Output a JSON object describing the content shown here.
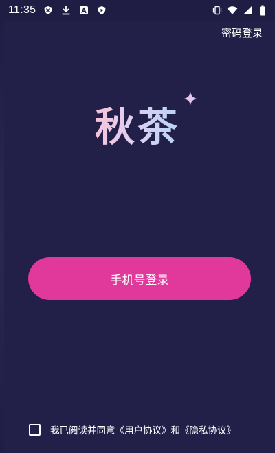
{
  "status_bar": {
    "time": "11:35",
    "left_icons": [
      "shield-x-icon",
      "download-icon",
      "font-a-icon",
      "play-shield-icon"
    ],
    "right_icons": [
      "vibrate-icon",
      "wifi-icon",
      "signal-icon",
      "battery-icon"
    ]
  },
  "header": {
    "password_login_label": "密码登录"
  },
  "logo": {
    "text": "秋茶",
    "decoration_icon": "sparkle-icon"
  },
  "main": {
    "phone_login_label": "手机号登录"
  },
  "agreement": {
    "prefix": "我已阅读并同意",
    "user_agreement": "《用户协议》",
    "conjunction": "和",
    "privacy_policy": "《隐私协议》"
  },
  "colors": {
    "background": "#221f49",
    "primary_button": "#e0389b",
    "text": "#ffffff"
  }
}
